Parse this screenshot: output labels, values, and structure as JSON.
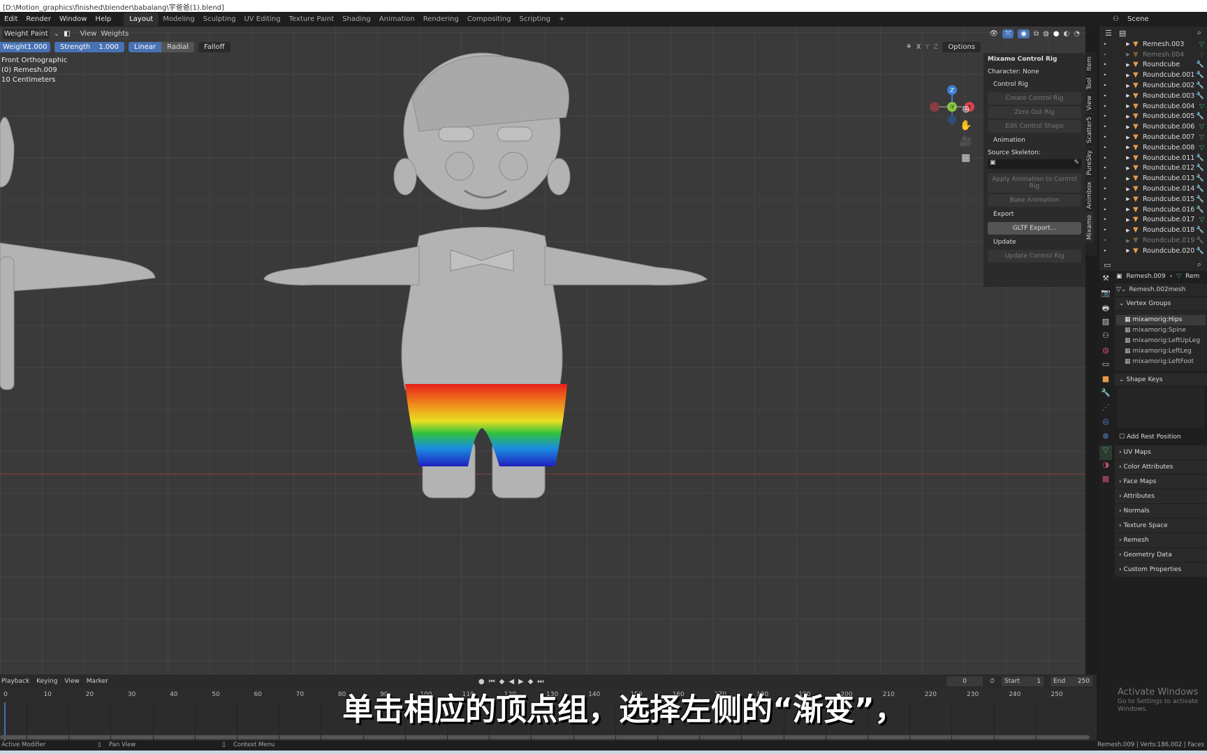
{
  "title_bar": "[D:\\Motion_graphics\\finished\\blender\\babalang\\宇爸爸(1).blend]",
  "menu": [
    "Edit",
    "Render",
    "Window",
    "Help"
  ],
  "workspaces": [
    "Layout",
    "Modeling",
    "Sculpting",
    "UV Editing",
    "Texture Paint",
    "Shading",
    "Animation",
    "Rendering",
    "Compositing",
    "Scripting",
    "+"
  ],
  "active_workspace": "Layout",
  "scene": "Scene",
  "viewport": {
    "mode": "Weight Paint",
    "menus": [
      "View",
      "Weights"
    ],
    "weight_label": "Weight",
    "weight_value": "1.000",
    "strength_label": "Strength",
    "strength_value": "1.000",
    "linear": "Linear",
    "radial": "Radial",
    "falloff": "Falloff",
    "options": "Options",
    "axes": [
      "X",
      "Y",
      "Z"
    ],
    "overlay": [
      "Front Orthographic",
      "(0) Remesh.009",
      "10 Centimeters"
    ],
    "gizmo": {
      "z": "Z",
      "y": "-Y",
      "x": "X"
    }
  },
  "npanel": {
    "title": "Mixamo Control Rig",
    "character": "Character: None",
    "control_rig": "Control Rig",
    "create": "Create Control Rig",
    "zero": "Zero Out Rig",
    "edit_shape": "Edit Control Shape",
    "animation": "Animation",
    "source_skeleton": "Source Skeleton:",
    "apply": "Apply Animation to Control Rig",
    "bake": "Bake Animation",
    "export": "Export",
    "gltf": "GLTF Export...",
    "update": "Update",
    "update_rig": "Update Control Rig",
    "tabs": [
      "Item",
      "Tool",
      "View",
      "Scatter5",
      "PureSky",
      "Animbox",
      "Mixamo"
    ]
  },
  "outliner": {
    "items": [
      {
        "name": "Remesh.003",
        "dim": false,
        "mod": "g"
      },
      {
        "name": "Remesh.004",
        "dim": true,
        "mod": "g"
      },
      {
        "name": "Roundcube",
        "dim": false,
        "mod": "b"
      },
      {
        "name": "Roundcube.001",
        "dim": false,
        "mod": "b"
      },
      {
        "name": "Roundcube.002",
        "dim": false,
        "mod": "b"
      },
      {
        "name": "Roundcube.003",
        "dim": false,
        "mod": "b"
      },
      {
        "name": "Roundcube.004",
        "dim": false,
        "mod": "g"
      },
      {
        "name": "Roundcube.005",
        "dim": false,
        "mod": "b"
      },
      {
        "name": "Roundcube.006",
        "dim": false,
        "mod": "g"
      },
      {
        "name": "Roundcube.007",
        "dim": false,
        "mod": "g"
      },
      {
        "name": "Roundcube.008",
        "dim": false,
        "mod": "g"
      },
      {
        "name": "Roundcube.011",
        "dim": false,
        "mod": "b"
      },
      {
        "name": "Roundcube.012",
        "dim": false,
        "mod": "b"
      },
      {
        "name": "Roundcube.013",
        "dim": false,
        "mod": "b"
      },
      {
        "name": "Roundcube.014",
        "dim": false,
        "mod": "b"
      },
      {
        "name": "Roundcube.015",
        "dim": false,
        "mod": "b"
      },
      {
        "name": "Roundcube.016",
        "dim": false,
        "mod": "b"
      },
      {
        "name": "Roundcube.017",
        "dim": false,
        "mod": "g"
      },
      {
        "name": "Roundcube.018",
        "dim": false,
        "mod": "b"
      },
      {
        "name": "Roundcube.019",
        "dim": true,
        "mod": "b"
      },
      {
        "name": "Roundcube.020",
        "dim": false,
        "mod": "b"
      }
    ]
  },
  "properties": {
    "breadcrumb_object": "Remesh.009",
    "breadcrumb_data": "Rem",
    "mesh": "Remesh.002mesh",
    "vertex_groups": "Vertex Groups",
    "groups": [
      "mixamorig:Hips",
      "mixamorig:Spine",
      "mixamorig:LeftUpLeg",
      "mixamorig:LeftLeg",
      "mixamorig:LeftFoot"
    ],
    "shape_keys": "Shape Keys",
    "add_rest": "Add Rest Position",
    "sections": [
      "UV Maps",
      "Color Attributes",
      "Face Maps",
      "Attributes",
      "Normals",
      "Texture Space",
      "Remesh",
      "Geometry Data",
      "Custom Properties"
    ]
  },
  "timeline": {
    "menus": [
      "Playback",
      "Keying",
      "View",
      "Marker"
    ],
    "current": "0",
    "start_label": "Start",
    "start": "1",
    "end_label": "End",
    "end": "250",
    "ticks": [
      "0",
      "10",
      "20",
      "30",
      "40",
      "50",
      "60",
      "70",
      "80",
      "90",
      "100",
      "110",
      "120",
      "130",
      "140",
      "150",
      "160",
      "170",
      "180",
      "190",
      "200",
      "210",
      "220",
      "230",
      "240",
      "250"
    ]
  },
  "subtitle": "单击相应的顶点组，选择左侧的“渐变”，",
  "watermark": {
    "line1": "Activate Windows",
    "line2": "Go to Settings to activate Windows."
  },
  "status": {
    "left": "Active Modifier",
    "mid1": "Pan View",
    "mid2": "Context Menu",
    "right": "Remesh.009 | Verts:186,002 | Faces"
  },
  "colors": {
    "accent": "#4772b3",
    "mesh_icon": "#e59a4c",
    "x_axis": "#e0424d",
    "y_axis": "#8ac53f",
    "z_axis": "#3b7fd1"
  }
}
